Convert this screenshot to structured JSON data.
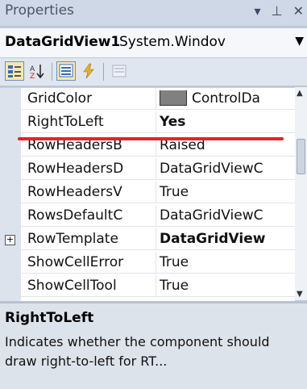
{
  "panel": {
    "title": "Properties",
    "icons": [
      "▾",
      "⊥",
      "✕"
    ]
  },
  "object_selector": {
    "name": "DataGridView1",
    "type": "System.Windov"
  },
  "toolbar": {
    "buttons": [
      "categorized-icon",
      "alphabetical-icon",
      "properties-icon",
      "events-icon",
      "property-pages-icon"
    ]
  },
  "properties": [
    {
      "name": "GridColor",
      "value": "ControlDa"
    },
    {
      "name": "RightToLeft",
      "value": "Yes"
    },
    {
      "name": "RowHeadersB",
      "value": "Raised"
    },
    {
      "name": "RowHeadersD",
      "value": "DataGridViewC"
    },
    {
      "name": "RowHeadersV",
      "value": "True"
    },
    {
      "name": "RowsDefaultC",
      "value": "DataGridViewC"
    },
    {
      "name": "RowTemplate",
      "value": "DataGridView"
    },
    {
      "name": "ShowCellError",
      "value": "True"
    },
    {
      "name": "ShowCellTool",
      "value": "True"
    }
  ],
  "description": {
    "title": "RightToLeft",
    "text": "Indicates whether the component should draw right-to-left for RT..."
  },
  "colors": {
    "highlight": "#e8222d",
    "swatch": "#808080"
  }
}
